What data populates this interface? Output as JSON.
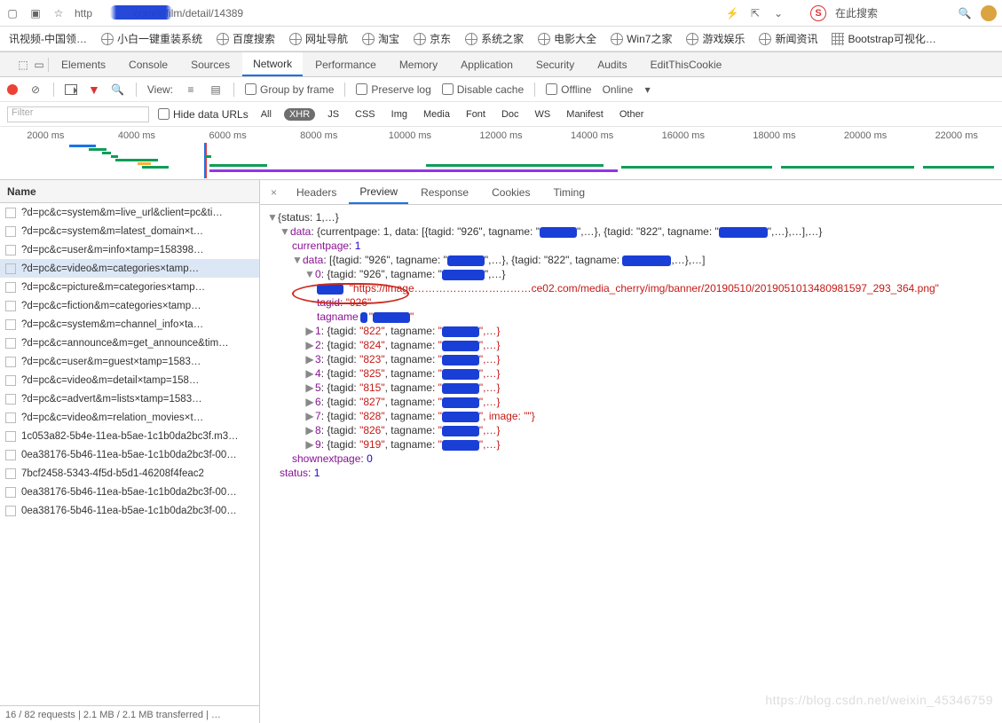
{
  "browser": {
    "url_visible": "http",
    "url_tail": "com/#/film/detail/14389",
    "search_placeholder": "在此搜索"
  },
  "bookmarks": [
    "讯视频-中国领…",
    "小白一键重装系统",
    "百度搜索",
    "网址导航",
    "淘宝",
    "京东",
    "系统之家",
    "电影大全",
    "Win7之家",
    "游戏娱乐",
    "新闻资讯",
    "Bootstrap可视化…"
  ],
  "devtool_tabs": [
    "Elements",
    "Console",
    "Sources",
    "Network",
    "Performance",
    "Memory",
    "Application",
    "Security",
    "Audits",
    "EditThisCookie"
  ],
  "controls": {
    "view": "View:",
    "group": "Group by frame",
    "preserve": "Preserve log",
    "disable": "Disable cache",
    "offline": "Offline",
    "online": "Online"
  },
  "filter": {
    "placeholder": "Filter",
    "hide": "Hide data URLs",
    "types": {
      "all": "All",
      "xhr": "XHR",
      "js": "JS",
      "css": "CSS",
      "img": "Img",
      "media": "Media",
      "font": "Font",
      "doc": "Doc",
      "ws": "WS",
      "manifest": "Manifest",
      "other": "Other"
    }
  },
  "timeline_labels": [
    "2000 ms",
    "4000 ms",
    "6000 ms",
    "8000 ms",
    "10000 ms",
    "12000 ms",
    "14000 ms",
    "16000 ms",
    "18000 ms",
    "20000 ms",
    "22000 ms"
  ],
  "name_header": "Name",
  "requests": [
    "?d=pc&c=system&m=live_url&client=pc&ti…",
    "?d=pc&c=system&m=latest_domain&timest…",
    "?d=pc&c=user&m=info&timestamp=158398…",
    "?d=pc&c=video&m=categories&timestamp…",
    "?d=pc&c=picture&m=categories&timestamp…",
    "?d=pc&c=fiction&m=categories&timestamp…",
    "?d=pc&c=system&m=channel_info&timesta…",
    "?d=pc&c=announce&m=get_announce&tim…",
    "?d=pc&c=user&m=guest&timestamp=1583…",
    "?d=pc&c=video&m=detail&timestamp=158…",
    "?d=pc&c=advert&m=lists&timestamp=1583…",
    "?d=pc&c=video&m=relation_movies&timest…",
    "1c053a82-5b4e-11ea-b5ae-1c1b0da2bc3f.m3…",
    "0ea38176-5b46-11ea-b5ae-1c1b0da2bc3f-00…",
    "7bcf2458-5343-4f5d-b5d1-46208f4feac2",
    "0ea38176-5b46-11ea-b5ae-1c1b0da2bc3f-00…",
    "0ea38176-5b46-11ea-b5ae-1c1b0da2bc3f-00…"
  ],
  "detail_tabs": [
    "Headers",
    "Preview",
    "Response",
    "Cookies",
    "Timing"
  ],
  "status_bar": "16 / 82 requests  |  2.1 MB / 2.1 MB transferred  |  …",
  "json": {
    "root": "{status: 1,…}",
    "data_summary": "{currentpage: 1, data: [{tagid: \"926\", tagname: \"",
    "data_inner_tail": "\",…}, {tagid: \"822\", tagname: \"",
    "currentpage_k": "currentpage",
    "currentpage_v": "1",
    "data_arr": "[{tagid: \"926\", tagname: \"",
    "data_arr_mid": "\",…}, {tagid: \"822\", tagname: ",
    "row0": "{tagid: \"926\", tagname: \"",
    "image_line": "\"https://image……………………………ce02.com/media_cherry/img/banner/20190510/2019051013480981597_293_364.png\"",
    "tagid_k": "tagid",
    "tagid_v": "\"926\"",
    "tagname_k": "tagname",
    "rows": [
      {
        "i": "1",
        "tag": "822",
        "suffix": "\",…}"
      },
      {
        "i": "2",
        "tag": "824",
        "suffix": "\",…}"
      },
      {
        "i": "3",
        "tag": "823",
        "suffix": "\",…}"
      },
      {
        "i": "4",
        "tag": "825",
        "suffix": "\",…}"
      },
      {
        "i": "5",
        "tag": "815",
        "suffix": "\",…}"
      },
      {
        "i": "6",
        "tag": "827",
        "suffix": "\",…}"
      },
      {
        "i": "7",
        "tag": "828",
        "suffix": "\", image: \"\"}"
      },
      {
        "i": "8",
        "tag": "826",
        "suffix": "\",…}"
      },
      {
        "i": "9",
        "tag": "919",
        "suffix": "\",…}"
      }
    ],
    "shownext_k": "shownextpage",
    "shownext_v": "0",
    "status_k": "status",
    "status_v": "1"
  },
  "watermark": "https://blog.csdn.net/weixin_45346759"
}
